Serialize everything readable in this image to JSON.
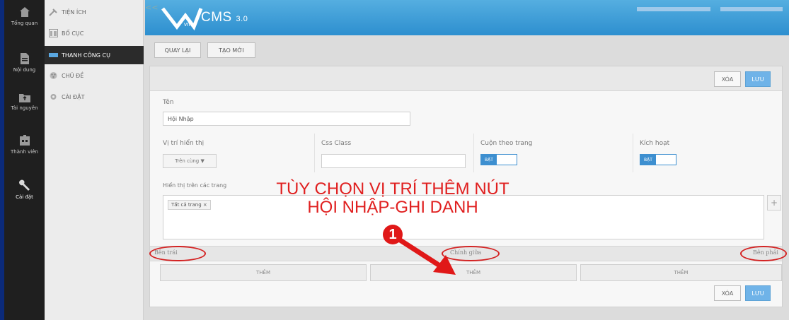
{
  "rail": {
    "items": [
      {
        "label": "Tổng quan",
        "icon": "home-icon"
      },
      {
        "label": "Nội dung",
        "icon": "document-icon"
      },
      {
        "label": "Tài nguyên",
        "icon": "folder-icon"
      },
      {
        "label": "Thành viên",
        "icon": "members-icon"
      },
      {
        "label": "Cài đặt",
        "icon": "wrench-icon"
      }
    ]
  },
  "menu": {
    "items": [
      {
        "label": "TIỆN ÍCH",
        "icon": "tools-icon"
      },
      {
        "label": "BỐ CỤC",
        "icon": "layout-icon"
      },
      {
        "label": "THANH CÔNG CỤ",
        "icon": "toolbar-icon",
        "active": true
      },
      {
        "label": "CHỦ ĐỀ",
        "icon": "theme-icon"
      },
      {
        "label": "CÀI ĐẶT",
        "icon": "settings-icon"
      }
    ]
  },
  "header": {
    "collapse": "<<",
    "logo_text": "CMS",
    "logo_version": "3.0",
    "logo_sub": "vnvn"
  },
  "toolbar": {
    "back_label": "QUAY LẠI",
    "new_label": "TẠO MỚI"
  },
  "panel": {
    "delete_label": "XÓA",
    "save_label": "LƯU"
  },
  "form": {
    "name_label": "Tên",
    "name_value": "Hội Nhập",
    "position_label": "Vị trí hiển thị",
    "position_value": "Trên cùng ▼",
    "css_label": "Css Class",
    "css_value": "",
    "scroll_label": "Cuộn theo trang",
    "scroll_toggle": "BẬT",
    "active_label": "Kích hoạt",
    "active_toggle": "BẬT",
    "pages_label": "Hiển thị trên các trang",
    "pages_tag": "Tất cả trang ×",
    "add_symbol": "+"
  },
  "sections": {
    "left": "Bên trái",
    "center": "Chính giữa",
    "right": "Bên phải",
    "add_label": "THÊM"
  },
  "annotation": {
    "line1": "TÙY CHỌN VỊ TRÍ THÊM NÚT",
    "line2": "HỘI NHẬP-GHI DANH",
    "badge": "1"
  }
}
